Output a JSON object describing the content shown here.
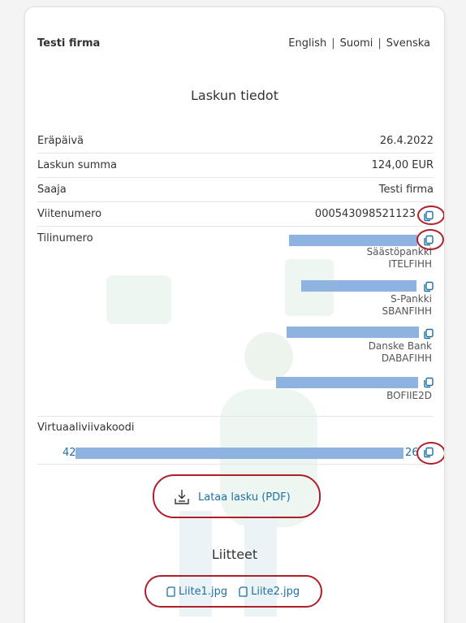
{
  "header": {
    "company": "Testi firma",
    "languages": [
      "English",
      "Suomi",
      "Svenska"
    ],
    "separator": "|"
  },
  "invoice": {
    "title": "Laskun tiedot",
    "due_date": {
      "label": "Eräpäivä",
      "value": "26.4.2022"
    },
    "amount": {
      "label": "Laskun summa",
      "value": "124,00 EUR"
    },
    "recipient": {
      "label": "Saaja",
      "value": "Testi firma"
    },
    "reference": {
      "label": "Viitenumero",
      "value": "000543098521123"
    },
    "account": {
      "label": "Tilinumero",
      "banks": [
        {
          "name": "Säästöpankki",
          "bic": "ITELFIHH"
        },
        {
          "name": "S-Pankki",
          "bic": "SBANFIHH"
        },
        {
          "name": "Danske Bank",
          "bic": "DABAFIHH"
        },
        {
          "name": "",
          "bic": "BOFIIE2D"
        }
      ]
    },
    "virtual_barcode": {
      "label": "Virtuaaliviivakoodi",
      "prefix": "42",
      "suffix": "26"
    }
  },
  "download": {
    "label": "Lataa lasku (PDF)"
  },
  "attachments": {
    "title": "Liitteet",
    "files": [
      "Liite1.jpg",
      "Liite2.jpg"
    ]
  },
  "colors": {
    "accent": "#1f6fa3",
    "highlight": "#b01e2a",
    "redaction": "#8fb3e0"
  }
}
